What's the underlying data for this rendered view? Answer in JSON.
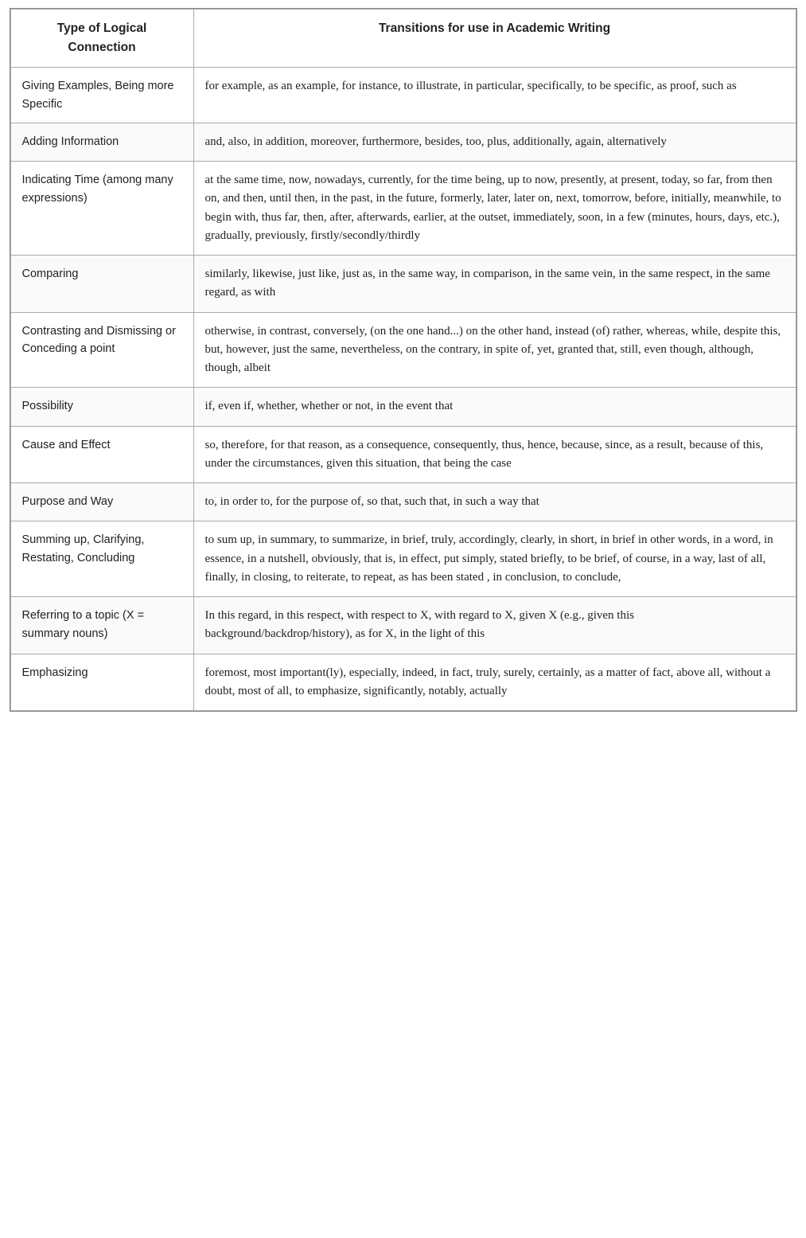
{
  "table": {
    "header": {
      "col1": "Type of Logical Connection",
      "col2": "Transitions for use in Academic Writing"
    },
    "rows": [
      {
        "type": "Giving Examples, Being more Specific",
        "transitions": "for example, as an example, for instance, to illustrate, in particular, specifically, to be specific, as proof, such as"
      },
      {
        "type": "Adding Information",
        "transitions": "and, also, in addition, moreover, furthermore, besides, too, plus, additionally, again, alternatively"
      },
      {
        "type": "Indicating Time (among many expressions)",
        "transitions": "at the same time, now, nowadays, currently, for the time being, up to now, presently, at present, today, so far, from then on, and then, until then, in the past, in the future, formerly, later, later on, next, tomorrow, before, initially, meanwhile, to begin with, thus far, then, after, afterwards, earlier, at the outset, immediately, soon, in a few (minutes, hours, days, etc.), gradually, previously, firstly/secondly/thirdly"
      },
      {
        "type": "Comparing",
        "transitions": "similarly, likewise, just like, just as, in the same way, in comparison, in the same vein, in the same respect, in the same regard, as with"
      },
      {
        "type": "Contrasting and Dismissing or Conceding a point",
        "transitions": "otherwise, in contrast, conversely, (on the one hand...) on the other hand, instead (of) rather, whereas, while, despite this, but, however, just the same, nevertheless, on the contrary, in spite of, yet, granted that, still, even though, although, though, albeit"
      },
      {
        "type": "Possibility",
        "transitions": "if, even if, whether, whether or not, in the event that"
      },
      {
        "type": "Cause and Effect",
        "transitions": "so, therefore, for that reason, as a consequence, consequently, thus, hence, because, since, as a result, because of this, under the circumstances, given this situation, that being the case"
      },
      {
        "type": "Purpose and Way",
        "transitions": "to, in order to, for the purpose of, so that, such that, in such a way that"
      },
      {
        "type": "Summing up, Clarifying, Restating, Concluding",
        "transitions": "to sum up, in summary, to summarize, in brief, truly, accordingly, clearly, in short, in brief in other words, in a word, in essence, in a nutshell, obviously, that is, in effect, put simply, stated briefly, to be brief, of course, in a way, last of all, finally, in closing, to reiterate, to repeat, as has been stated , in conclusion, to conclude,"
      },
      {
        "type": "Referring to a topic (X = summary nouns)",
        "transitions": "In this regard, in this respect, with respect to X, with regard to X, given X (e.g., given this background/backdrop/history), as for X, in the light of this"
      },
      {
        "type": "Emphasizing",
        "transitions": "foremost, most important(ly), especially, indeed, in fact, truly, surely, certainly, as a matter of fact, above all, without a doubt, most of all, to emphasize, significantly, notably, actually"
      }
    ]
  }
}
